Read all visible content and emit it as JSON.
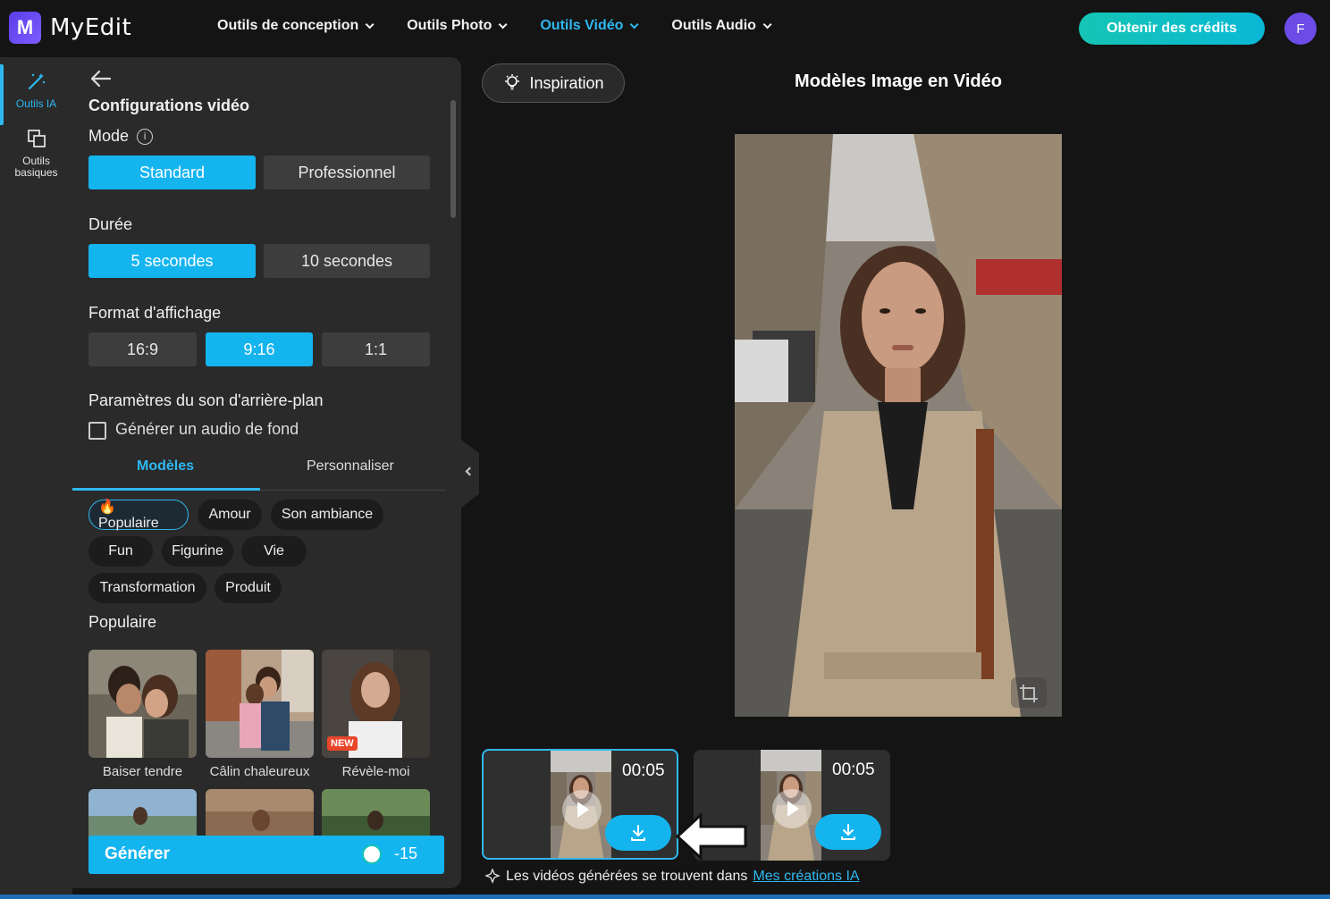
{
  "app": {
    "logo_letter": "M",
    "name": "MyEdit"
  },
  "nav": [
    {
      "label": "Outils de conception",
      "active": false
    },
    {
      "label": "Outils Photo",
      "active": false
    },
    {
      "label": "Outils Vidéo",
      "active": true
    },
    {
      "label": "Outils Audio",
      "active": false
    }
  ],
  "header": {
    "credits_label": "Obtenir des crédits",
    "avatar_initial": "F"
  },
  "rail": {
    "ai_tools": "Outils IA",
    "basic_tools": "Outils basiques"
  },
  "panel": {
    "title": "Configurations vidéo",
    "mode": {
      "label": "Mode",
      "info_glyph": "i",
      "options": [
        "Standard",
        "Professionnel"
      ],
      "selected": "Standard"
    },
    "duration": {
      "label": "Durée",
      "options": [
        "5 secondes",
        "10 secondes"
      ],
      "selected": "5 secondes"
    },
    "format": {
      "label": "Format d'affichage",
      "options": [
        "16:9",
        "9:16",
        "1:1"
      ],
      "selected": "9:16"
    },
    "sound": {
      "label": "Paramètres du son d'arrière-plan",
      "checkbox_label": "Générer un audio de fond",
      "checked": false
    },
    "tabs": [
      "Modèles",
      "Personnaliser"
    ],
    "chips": [
      "🔥 Populaire",
      "Amour",
      "Son ambiance",
      "Fun",
      "Figurine",
      "Vie",
      "Transformation",
      "Produit"
    ],
    "section_label": "Populaire",
    "templates": [
      {
        "label": "Baiser tendre",
        "badge": ""
      },
      {
        "label": "Câlin chaleureux",
        "badge": ""
      },
      {
        "label": "Révèle-moi",
        "badge": "NEW"
      }
    ],
    "generate": {
      "label": "Générer",
      "cost": "-15"
    }
  },
  "main": {
    "inspiration_label": "Inspiration",
    "title": "Modèles Image en Vidéo",
    "videos": [
      {
        "time": "00:05",
        "selected": true
      },
      {
        "time": "00:05",
        "selected": false
      }
    ],
    "note_prefix": "Les vidéos générées se trouvent dans",
    "note_link": "Mes créations IA"
  },
  "colors": {
    "accent": "#14b4ef",
    "brand": "#5b3ee8",
    "credits": "#14c5b4"
  }
}
